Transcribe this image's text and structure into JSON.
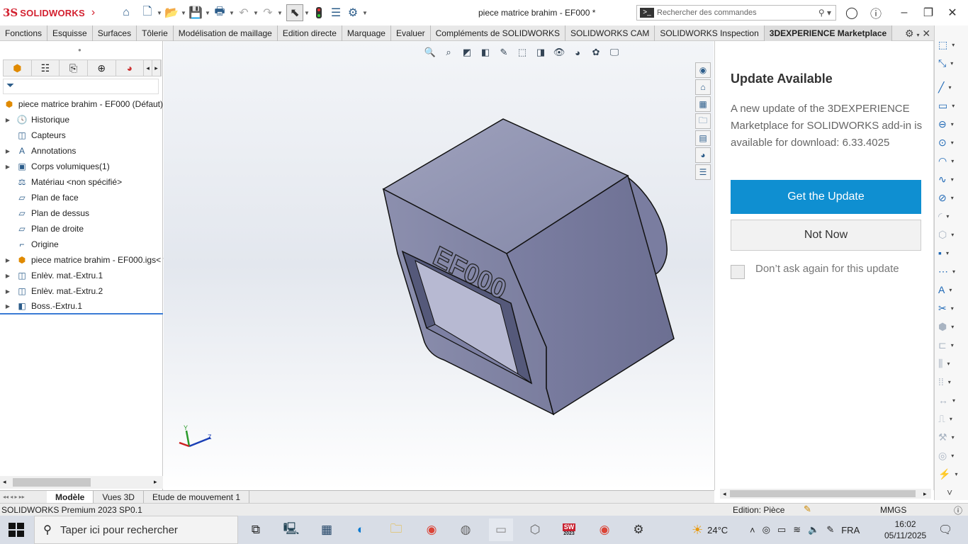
{
  "app": {
    "brand_ds": "3S",
    "brand_name": "SOLIDWORKS",
    "window_title": "piece matrice brahim - EF000 *",
    "search_placeholder": "Rechercher des commandes"
  },
  "toolbar_icons": [
    "home-icon",
    "new-document-icon",
    "open-icon",
    "save-icon",
    "print-icon",
    "undo-icon",
    "redo-icon",
    "select-icon",
    "rebuild-icon",
    "file-properties-icon",
    "options-icon"
  ],
  "command_tabs": [
    {
      "label": "Fonctions",
      "active": false
    },
    {
      "label": "Esquisse",
      "active": false
    },
    {
      "label": "Surfaces",
      "active": false
    },
    {
      "label": "Tôlerie",
      "active": false
    },
    {
      "label": "Modélisation de maillage",
      "active": false
    },
    {
      "label": "Edition directe",
      "active": false
    },
    {
      "label": "Marquage",
      "active": false
    },
    {
      "label": "Evaluer",
      "active": false
    },
    {
      "label": "Compléments de SOLIDWORKS",
      "active": false
    },
    {
      "label": "SOLIDWORKS CAM",
      "active": false
    },
    {
      "label": "SOLIDWORKS Inspection",
      "active": false
    },
    {
      "label": "3DEXPERIENCE Marketplace",
      "active": true
    }
  ],
  "feature_tree": {
    "root": "piece matrice brahim - EF000  (Défaut)",
    "items": [
      {
        "label": "Historique",
        "expandable": true,
        "icon": "history-folder-icon"
      },
      {
        "label": "Capteurs",
        "expandable": false,
        "icon": "sensors-icon"
      },
      {
        "label": "Annotations",
        "expandable": true,
        "icon": "annotations-icon"
      },
      {
        "label": "Corps volumiques(1)",
        "expandable": true,
        "icon": "solid-bodies-icon"
      },
      {
        "label": "Matériau <non spécifié>",
        "expandable": false,
        "icon": "material-icon"
      },
      {
        "label": "Plan de face",
        "expandable": false,
        "icon": "plane-icon"
      },
      {
        "label": "Plan de dessus",
        "expandable": false,
        "icon": "plane-icon"
      },
      {
        "label": "Plan de droite",
        "expandable": false,
        "icon": "plane-icon"
      },
      {
        "label": "Origine",
        "expandable": false,
        "icon": "origin-icon"
      },
      {
        "label": "piece matrice brahim - EF000.igs<",
        "expandable": true,
        "icon": "imported-part-icon"
      },
      {
        "label": "Enlèv. mat.-Extru.1",
        "expandable": true,
        "icon": "cut-extrude-icon"
      },
      {
        "label": "Enlèv. mat.-Extru.2",
        "expandable": true,
        "icon": "cut-extrude-icon"
      },
      {
        "label": "Boss.-Extru.1",
        "expandable": true,
        "icon": "boss-extrude-icon"
      }
    ]
  },
  "model": {
    "engraving": "EF000",
    "triad": {
      "y": "Y",
      "z": "Z"
    }
  },
  "update_panel": {
    "title": "Update Available",
    "message": "A new update of the 3DEXPERIENCE Marketplace for SOLIDWORKS add-in is available for download: 6.33.4025",
    "primary_button": "Get the Update",
    "secondary_button": "Not Now",
    "checkbox_label": "Don’t ask again for this update",
    "checkbox_checked": false,
    "accent_color": "#0f8fd1"
  },
  "bottom_tabs": [
    {
      "label": "Modèle",
      "active": true
    },
    {
      "label": "Vues 3D",
      "active": false
    },
    {
      "label": "Etude de mouvement 1",
      "active": false
    }
  ],
  "status": {
    "product": "SOLIDWORKS Premium 2023 SP0.1",
    "edition": "Edition: Pièce",
    "units": "MMGS"
  },
  "taskbar": {
    "search_placeholder": "Taper ici pour rechercher",
    "temperature": "24°C",
    "language": "FRA",
    "time": "16:02",
    "date": "05/11/2025",
    "sw_badge": "2023"
  }
}
